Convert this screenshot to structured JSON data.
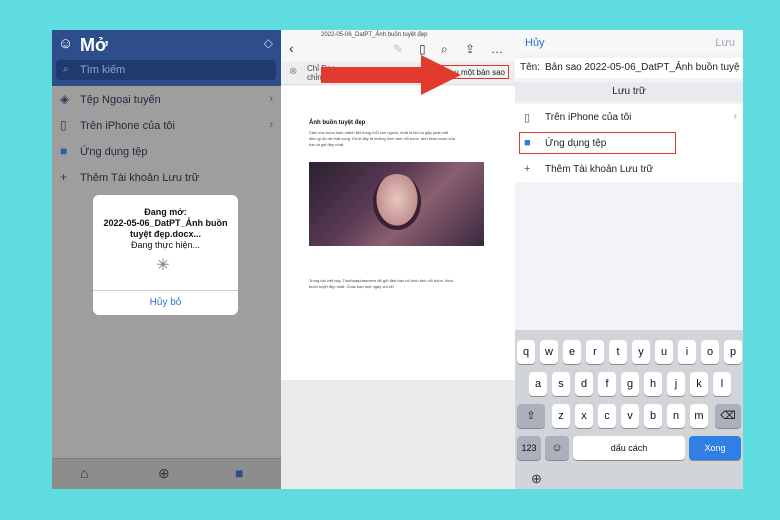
{
  "files_app": {
    "title": "Mở",
    "search_placeholder": "Tìm kiếm",
    "locations": [
      {
        "label": "Tệp Ngoại tuyến",
        "icon": "offline-files-icon",
        "chevron": "›"
      },
      {
        "label": "Trên iPhone của tôi",
        "icon": "phone-icon",
        "chevron": "›"
      },
      {
        "label": "Ứng dụng tệp",
        "icon": "folder-icon",
        "chevron": ""
      },
      {
        "label": "Thêm Tài khoản Lưu trữ",
        "icon": "plus-icon",
        "chevron": ""
      }
    ],
    "dialog": {
      "line1": "Đang mở:",
      "line2": "2022-05-06_DatPT_Ảnh buồn",
      "line3": "tuyệt đẹp.docx...",
      "line4": "Đang thực hiện...",
      "cancel": "Hủy bỏ"
    }
  },
  "document": {
    "filename": "2022-05-06_DatPT_Ảnh buồn tuyệt đẹp",
    "readonly_label": "Chỉ Đọc - chỉnh sửa.",
    "save_copy_label": "u một bản sao",
    "heading": "Ảnh buồn tuyệt đẹp",
    "para1_line1": "Cảm xúc buồn luôn mãnh liệt trong mỗi con người, nhất là khi họ gặp phải một",
    "para1_line2": "điều gì đó rất thất vọng. Dưới đây là những hình ảnh nỗi buồn, ảnh khóc buồn của",
    "para1_line3": "trai và gái đẹp nhất.",
    "para2_line1": "Trong bài viết này, Thuthuatphanmem đã gửi đến bạn bộ hình ảnh nỗi buồn, khóc",
    "para2_line2": "buồn tuyệt đẹp nhất. Chúc bạn một ngày vui vẻ!"
  },
  "save_dialog": {
    "cancel": "Hủy",
    "save": "Lưu",
    "name_label": "Tên:",
    "name_value": "Bản sao 2022-05-06_DatPT_Ảnh buồn tuyệ",
    "section": "Lưu trữ",
    "locations": [
      {
        "label": "Trên iPhone của tôi",
        "icon": "phone-icon",
        "chevron": "›"
      },
      {
        "label": "Ứng dụng tệp",
        "icon": "folder-icon",
        "chevron": ""
      },
      {
        "label": "Thêm Tài khoản Lưu trữ",
        "icon": "plus-icon",
        "chevron": ""
      }
    ]
  },
  "keyboard": {
    "row1": [
      "q",
      "w",
      "e",
      "r",
      "t",
      "y",
      "u",
      "i",
      "o",
      "p"
    ],
    "row2": [
      "a",
      "s",
      "d",
      "f",
      "g",
      "h",
      "j",
      "k",
      "l"
    ],
    "row3": [
      "z",
      "x",
      "c",
      "v",
      "b",
      "n",
      "m"
    ],
    "numbers_key": "123",
    "space_key": "dấu cách",
    "done_key": "Xong"
  }
}
